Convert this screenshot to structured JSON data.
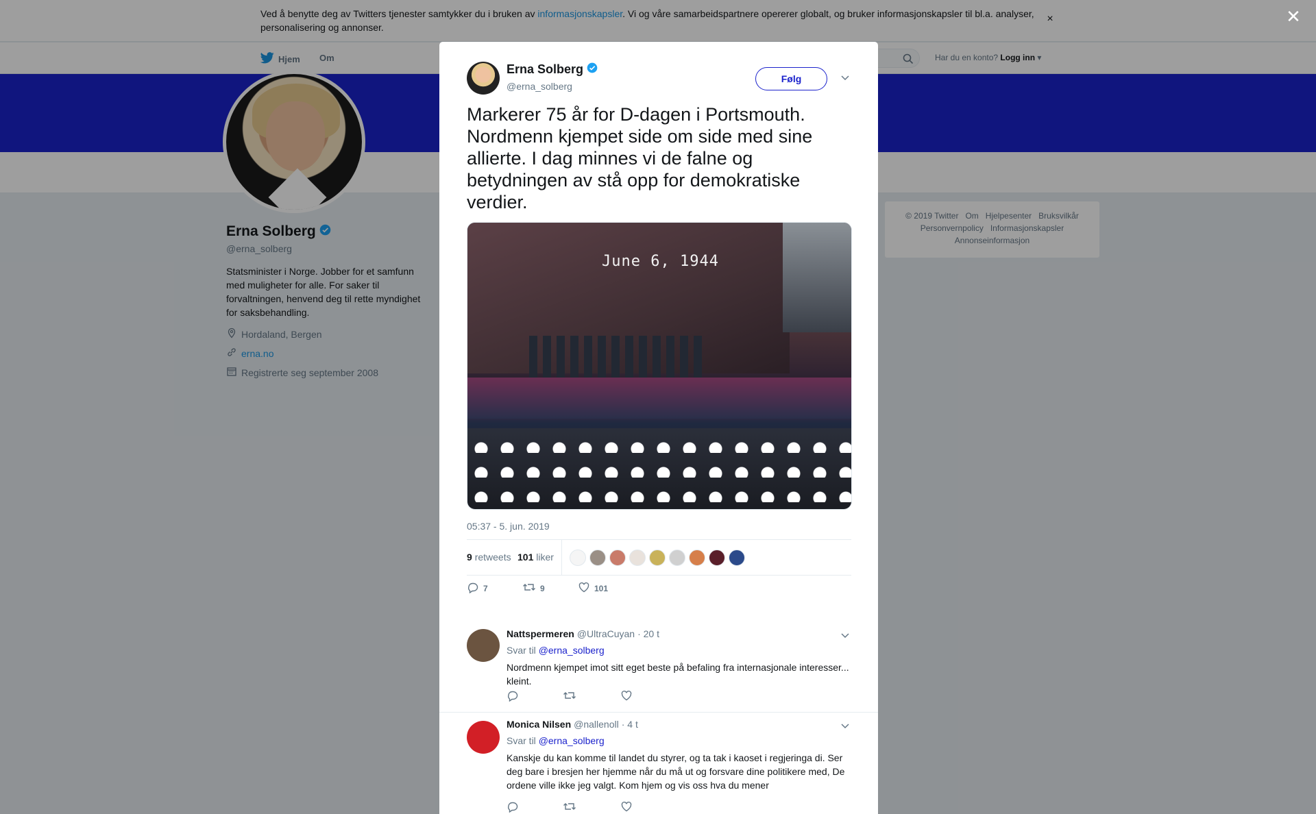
{
  "cookie_bar": {
    "text_before": "Ved å benytte deg av Twitters tjenester samtykker du i bruken av ",
    "link": "informasjonskapsler",
    "text_after": ". Vi og våre samarbeidspartnere opererer globalt, og bruker informasjonskapsler til bl.a. analyser, personalisering og annonser.",
    "close_glyph": "×"
  },
  "nav": {
    "home_label": "Hjem",
    "about_label": "Om",
    "login_prompt": "Har du en konto?",
    "login_label": "Logg inn"
  },
  "profile": {
    "name": "Erna Solberg",
    "handle": "@erna_solberg",
    "bio": "Statsminister i Norge. Jobber for et samfunn med muligheter for alle. For saker til forvaltningen, henvend deg til rette myndighet for saksbehandling.",
    "location": "Hordaland, Bergen",
    "website": "erna.no",
    "joined": "Registrerte seg september 2008"
  },
  "footer": {
    "line1": [
      "© 2019 Twitter",
      "Om",
      "Hjelpesenter",
      "Bruksvilkår"
    ],
    "line2": [
      "Personvernpolicy",
      "Informasjonskapsler"
    ],
    "line3": [
      "Annonseinformasjon"
    ]
  },
  "modal": {
    "close_glyph": "✕",
    "author_name": "Erna Solberg",
    "author_handle": "@erna_solberg",
    "follow_label": "Følg",
    "tweet_text": "Markerer 75 år for D-dagen i Portsmouth. Nordmenn kjempet side om side med sine allierte. I dag minnes vi de falne og betydningen av stå opp for demokratiske verdier.",
    "photo_caption": "June 6, 1944",
    "timestamp": "05:37 - 5. jun. 2019",
    "retweets_count": "9",
    "retweets_label": "retweets",
    "likes_count": "101",
    "likes_label": "liker",
    "reply_count": "7",
    "retweet_action_count": "9",
    "like_action_count": "101",
    "liker_colors": [
      "#f5f5f5",
      "#9a8f86",
      "#c97b6a",
      "#e9e2dc",
      "#c9b25a",
      "#d0d0d0",
      "#d67f4a",
      "#5a1f2a",
      "#2b4a8a"
    ]
  },
  "replies": [
    {
      "name": "Nattspermeren",
      "handle": "@UltraCuyan",
      "time": "· 20 t",
      "reply_to_label": "Svar til",
      "reply_to_handle": "@erna_solberg",
      "text": "Nordmenn kjempet imot sitt eget beste på befaling fra internasjonale interesser... kleint.",
      "avatar_color": "#6b5440"
    },
    {
      "name": "Monica Nilsen",
      "handle": "@nallenoll",
      "time": "· 4 t",
      "reply_to_label": "Svar til",
      "reply_to_handle": "@erna_solberg",
      "text": "Kanskje du kan komme til landet du styrer, og ta tak i kaoset i regjeringa di. Ser deg bare i bresjen her hjemme når du må ut og forsvare dine politikere med, De ordene ville ikke jeg valgt. Kom hjem og vis oss hva du mener",
      "avatar_color": "#d21f26"
    }
  ],
  "colors": {
    "accent": "#1b22cc",
    "banner": "#1b22cc",
    "link": "#1b95e0",
    "verified": "#1da1f2"
  }
}
